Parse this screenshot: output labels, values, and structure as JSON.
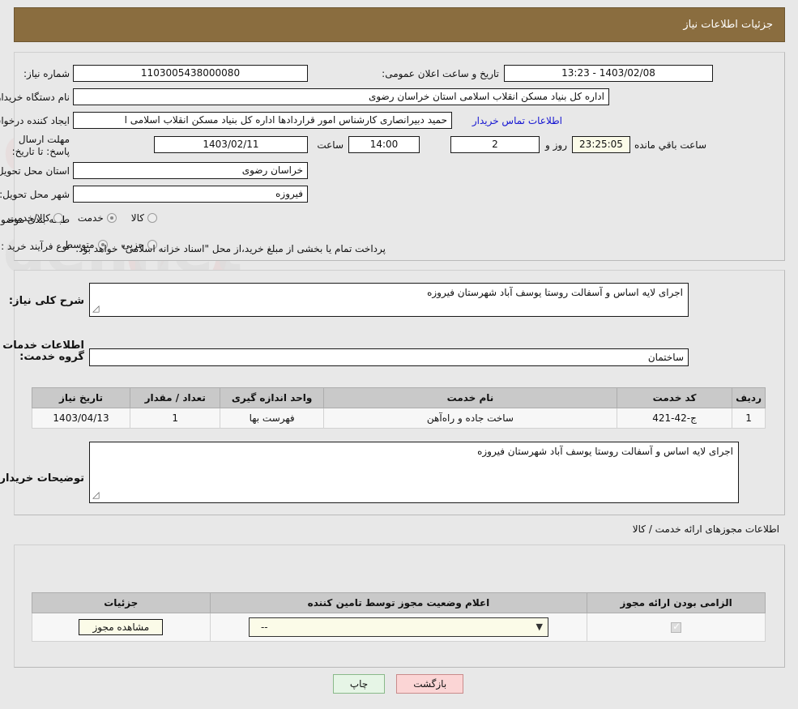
{
  "header": {
    "title": "جزئیات اطلاعات نیاز"
  },
  "form": {
    "need_number_label": "شماره نیاز:",
    "need_number_value": "1103005438000080",
    "announce_label": "تاریخ و ساعت اعلان عمومی:",
    "announce_value": "1403/02/08 - 13:23",
    "buyer_org_label": "نام دستگاه خریدار:",
    "buyer_org_value": "اداره کل بنیاد مسکن انقلاب اسلامی استان خراسان رضوی",
    "creator_label": "ایجاد کننده درخواست:",
    "creator_value": "حمید دبیرانصاری کارشناس امور قراردادها اداره کل بنیاد مسکن انقلاب اسلامی ا",
    "creator_link": "اطلاعات تماس خریدار",
    "deadline_label": "مهلت ارسال پاسخ: تا تاریخ:",
    "deadline_date": "1403/02/11",
    "deadline_hour_label": "ساعت",
    "deadline_hour": "14:00",
    "days_remaining": "2",
    "days_label": "روز و",
    "time_remaining": "23:25:05",
    "remaining_label": "ساعت باقي مانده",
    "province_label": "استان محل تحویل:",
    "province_value": "خراسان رضوی",
    "city_label": "شهر محل تحویل:",
    "city_value": "فیروزه",
    "category_label": "طبقه بندی موضوعی:",
    "category_options": [
      {
        "label": "کالا",
        "selected": false
      },
      {
        "label": "خدمت",
        "selected": true
      },
      {
        "label": "کالا/خدمت",
        "selected": false
      }
    ],
    "process_label": "نوع فرآیند خرید :",
    "process_options": [
      {
        "label": "جزیی",
        "selected": false
      },
      {
        "label": "متوسط",
        "selected": true
      }
    ],
    "process_note": "پرداخت تمام یا بخشی از مبلغ خرید،از محل \"اسناد خزانه اسلامی\" خواهد بود."
  },
  "description": {
    "summary_label": "شرح کلی نیاز:",
    "summary_value": "اجرای لایه اساس و آسفالت روستا یوسف آباد شهرستان فیروزه",
    "services_title": "اطلاعات خدمات مورد نیاز",
    "service_group_label": "گروه خدمت:",
    "service_group_value": "ساختمان"
  },
  "service_table": {
    "columns": [
      "ردیف",
      "کد خدمت",
      "نام خدمت",
      "واحد اندازه گیری",
      "تعداد / مقدار",
      "تاریخ نیاز"
    ],
    "rows": [
      {
        "row": "1",
        "code": "ج-42-421",
        "name": "ساخت جاده و راه‌آهن",
        "unit": "فهرست بها",
        "quantity": "1",
        "need_date": "1403/04/13"
      }
    ]
  },
  "buyer_remarks": {
    "label": "توضیحات خریدار:",
    "value": "اجرای لایه اساس و آسفالت روستا یوسف آباد شهرستان فیروزه"
  },
  "licenses": {
    "section_note": "اطلاعات مجوزهای ارائه خدمت / کالا",
    "columns": [
      "الزامی بودن ارائه مجوز",
      "اعلام وضعیت مجوز توسط تامین کننده",
      "جزئیات"
    ],
    "rows": [
      {
        "required": true,
        "status_value": "--",
        "details_button": "مشاهده مجوز"
      }
    ]
  },
  "footer": {
    "print_label": "چاپ",
    "back_label": "بازگشت"
  },
  "watermark": {
    "text": "AriaTender.net"
  },
  "colors": {
    "header_bg": "#8a6d3f",
    "panel_bg": "#e8e8e8",
    "link": "#1414d2",
    "print_btn": "#e6f5e6",
    "back_btn": "#fbd5d5",
    "cream_field": "#fbfbe8"
  }
}
